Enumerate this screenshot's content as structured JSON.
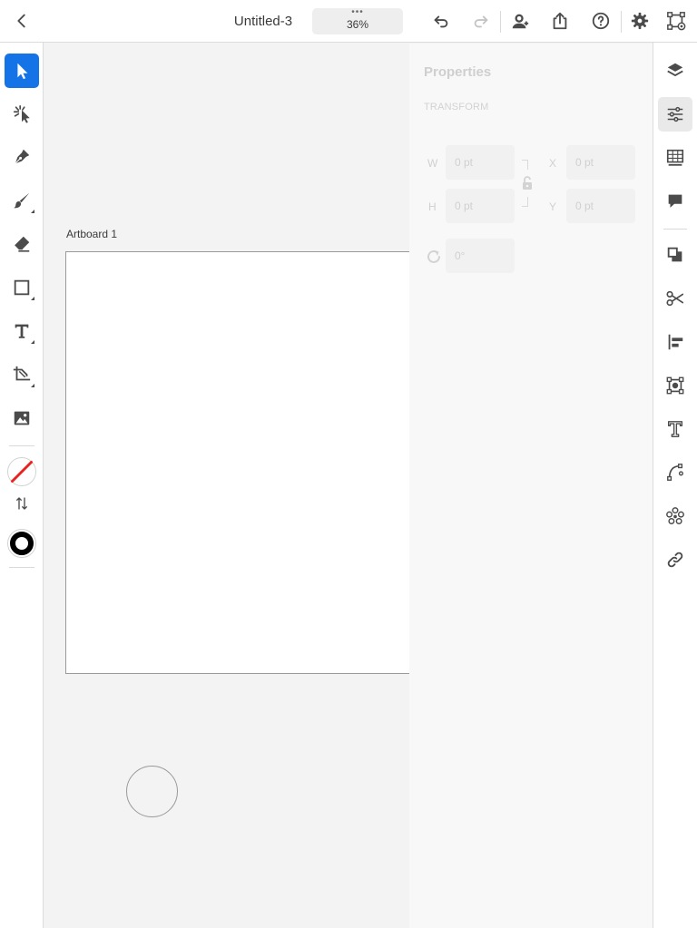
{
  "header": {
    "title": "Untitled-3",
    "zoom_dots": "•••",
    "zoom": "36%"
  },
  "canvas": {
    "artboard_label": "Artboard 1"
  },
  "properties": {
    "title": "Properties",
    "section": "TRANSFORM",
    "width_label": "W",
    "width_value": "0 pt",
    "height_label": "H",
    "height_value": "0 pt",
    "x_label": "X",
    "x_value": "0 pt",
    "y_label": "Y",
    "y_value": "0 pt",
    "rotation_value": "0°"
  },
  "colors": {
    "accent": "#1473e6",
    "icon": "#4b4b4b",
    "no_fill_slash": "#e8231f",
    "stroke": "#000000"
  },
  "icons": {
    "top_left": [
      "chevron-left-icon"
    ],
    "top_right": [
      "undo-icon",
      "redo-icon",
      "invite-user-icon",
      "share-icon",
      "help-icon",
      "settings-gear-icon",
      "artboard-preview-icon"
    ],
    "left_tools": [
      "selection-arrow-icon",
      "direct-selection-icon",
      "pen-icon",
      "brush-icon",
      "eraser-icon",
      "rectangle-icon",
      "type-icon",
      "crop-icon",
      "image-icon",
      "swap-icon"
    ],
    "right_panels": [
      "layers-icon",
      "properties-sliders-icon",
      "libraries-icon",
      "comments-icon",
      "arrange-icon",
      "cut-icon",
      "align-icon",
      "mask-icon",
      "type-panel-icon",
      "path-icon",
      "repeat-icon",
      "link-icon"
    ]
  }
}
